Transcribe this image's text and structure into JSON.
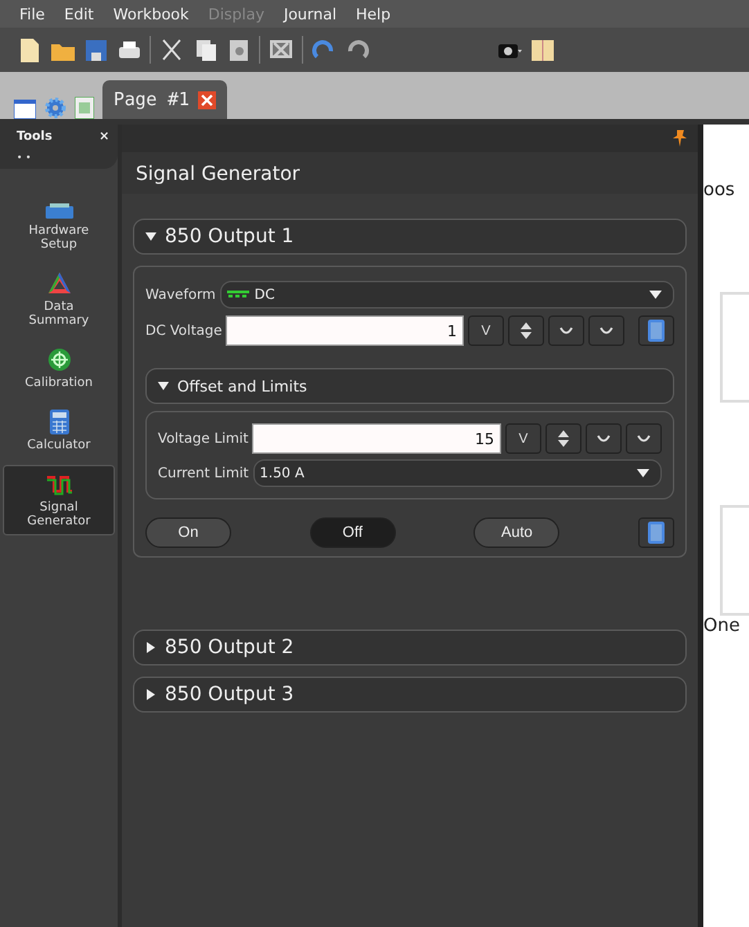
{
  "menu": [
    {
      "label": "File",
      "disabled": false
    },
    {
      "label": "Edit",
      "disabled": false
    },
    {
      "label": "Workbook",
      "disabled": false
    },
    {
      "label": "Display",
      "disabled": true
    },
    {
      "label": "Journal",
      "disabled": false
    },
    {
      "label": "Help",
      "disabled": false
    }
  ],
  "tabs": [
    {
      "label": "Page #1",
      "selected": true
    }
  ],
  "tools": {
    "title": "Tools",
    "close": "×",
    "grip": "• •",
    "items": [
      {
        "label": "Hardware Setup",
        "kind": "hardware",
        "selected": false
      },
      {
        "label": "Data Summary",
        "kind": "summary",
        "selected": false
      },
      {
        "label": "Calibration",
        "kind": "calibration",
        "selected": false
      },
      {
        "label": "Calculator",
        "kind": "calculator",
        "selected": false
      },
      {
        "label": "Signal Generator",
        "kind": "signal",
        "selected": true
      }
    ]
  },
  "panel": {
    "title": "Signal Generator",
    "outputs": [
      {
        "label": "850 Output 1",
        "expanded": true
      },
      {
        "label": "850 Output 2",
        "expanded": false
      },
      {
        "label": "850 Output 3",
        "expanded": false
      }
    ],
    "waveform": {
      "label": "Waveform",
      "value": "DC"
    },
    "dc_voltage": {
      "label": "DC Voltage",
      "value": "1",
      "unit": "V"
    },
    "offset": {
      "label": "Offset and Limits",
      "expanded": true,
      "voltage_limit": {
        "label": "Voltage Limit",
        "value": "15",
        "unit": "V"
      },
      "current_limit": {
        "label": "Current Limit",
        "value": "1.50 A"
      }
    },
    "buttons": [
      {
        "label": "On",
        "selected": false
      },
      {
        "label": "Off",
        "selected": true
      },
      {
        "label": "Auto",
        "selected": false
      }
    ]
  },
  "page": {
    "texts": [
      "oos",
      "One"
    ]
  }
}
